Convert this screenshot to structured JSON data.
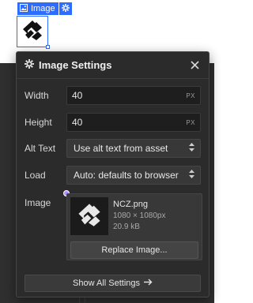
{
  "selection": {
    "tag_label": "Image",
    "tag_icon": "image-icon",
    "gear_icon": "gear-icon",
    "accent": "#2e6bff"
  },
  "panel": {
    "title": "Image Settings",
    "title_icon": "gear-icon",
    "close_icon": "close-icon",
    "width": {
      "label": "Width",
      "value": "40",
      "unit": "PX"
    },
    "height": {
      "label": "Height",
      "value": "40",
      "unit": "PX"
    },
    "alt_text": {
      "label": "Alt Text",
      "value": "Use alt text from asset"
    },
    "load": {
      "label": "Load",
      "value": "Auto: defaults to browser"
    },
    "image": {
      "label": "Image",
      "file_name": "NCZ.png",
      "dimensions": "1080 × 1080px",
      "file_size": "20.9 kB",
      "replace_label": "Replace Image...",
      "indicator_color": "#b48cff"
    },
    "show_all_label": "Show All Settings",
    "show_all_icon": "arrow-right-icon"
  }
}
